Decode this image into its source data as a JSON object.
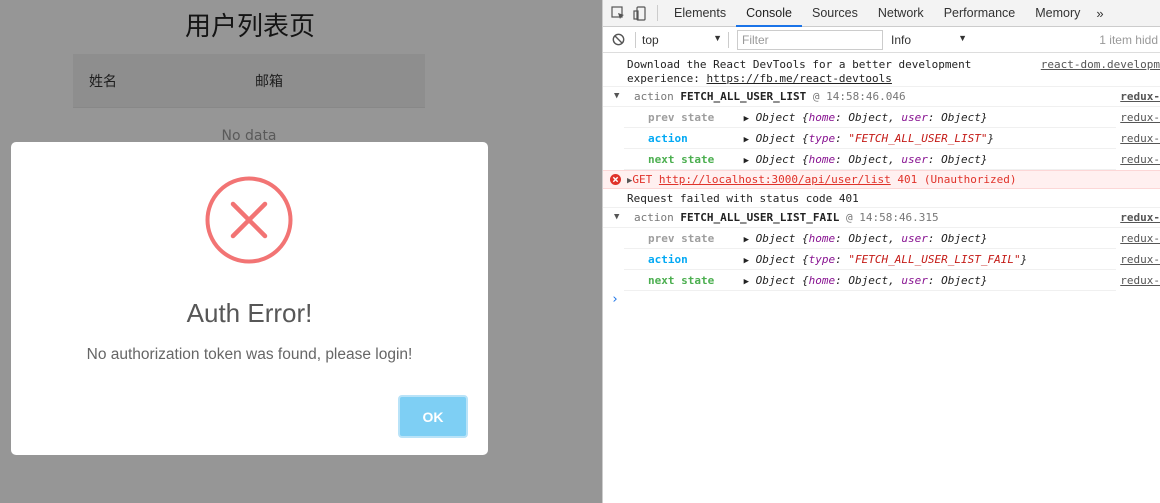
{
  "app": {
    "page_title": "用户列表页",
    "table": {
      "columns": [
        "姓名",
        "邮箱"
      ],
      "empty_text": "No data"
    },
    "modal": {
      "icon": "error-x-icon",
      "title": "Auth Error!",
      "message": "No authorization token was found, please login!",
      "ok_label": "OK"
    }
  },
  "devtools": {
    "tabs": [
      "Elements",
      "Console",
      "Sources",
      "Network",
      "Performance",
      "Memory"
    ],
    "active_tab": "Console",
    "more_label": "»",
    "context_value": "top",
    "filter_placeholder": "Filter",
    "level_value": "Info",
    "hidden_count": "1 item hidd",
    "logs": {
      "react_line1": "Download the React DevTools for a better development",
      "react_line2_prefix": "experience: ",
      "react_link": "https://fb.me/react-devtools",
      "react_src": "react-dom.developm",
      "group1": {
        "label": "action",
        "name": "FETCH_ALL_USER_LIST",
        "at": "@",
        "time": "14:58:46.046",
        "src": "redux-"
      },
      "group1_prev": {
        "label": "prev state",
        "src": "redux-"
      },
      "group1_action": {
        "label": "action",
        "type_value": "\"FETCH_ALL_USER_LIST\"",
        "src": "redux-"
      },
      "group1_next": {
        "label": "next state",
        "src": "redux-"
      },
      "err_method": "GET",
      "err_url": "http://localhost:3000/api/user/list",
      "err_status": "401 (Unauthorized)",
      "req_failed": "Request failed with status code 401",
      "group2": {
        "label": "action",
        "name": "FETCH_ALL_USER_LIST_FAIL",
        "at": "@",
        "time": "14:58:46.315",
        "src": "redux-"
      },
      "group2_prev": {
        "label": "prev state",
        "src": "redux-"
      },
      "group2_action": {
        "label": "action",
        "type_value": "\"FETCH_ALL_USER_LIST_FAIL\"",
        "src": "redux-"
      },
      "group2_next": {
        "label": "next state",
        "src": "redux-"
      },
      "obj_word": "Object",
      "key_home": "home",
      "key_user": "user",
      "key_type": "type",
      "prompt": "›"
    }
  },
  "colors": {
    "accent": "#7ecff4",
    "error_icon": "#f27474",
    "error_text": "#e0322a",
    "action_blue": "#03a9f4",
    "next_green": "#4caf50"
  }
}
